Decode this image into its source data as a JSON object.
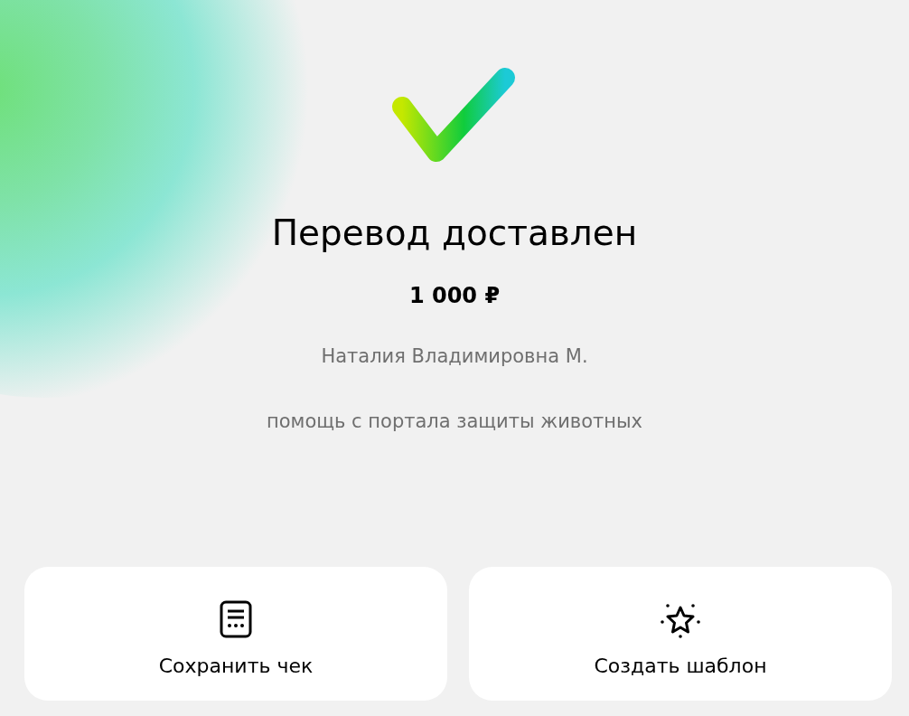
{
  "status": {
    "title": "Перевод доставлен",
    "amount": "1 000 ₽",
    "recipient": "Наталия Владимировна М.",
    "message": "помощь с портала защиты животных"
  },
  "actions": [
    {
      "kind": "receipt",
      "label": "Сохранить чек"
    },
    {
      "kind": "template",
      "label": "Создать шаблон"
    }
  ]
}
